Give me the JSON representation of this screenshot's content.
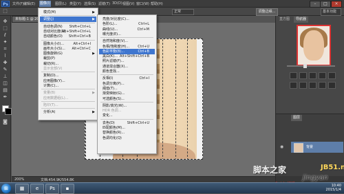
{
  "menubar": {
    "logo": "Ps",
    "items": [
      "文件(F)",
      "编辑(E)",
      "图像(I)",
      "图层(L)",
      "类型(Y)",
      "选择(S)",
      "滤镜(T)",
      "3D(D)",
      "视图(V)",
      "窗口(W)",
      "帮助(H)"
    ],
    "active_index": 2
  },
  "options": {
    "mode": "正常",
    "edge_button": "调整边缘...",
    "workspace": "基本功能"
  },
  "doc_tab": "未标题-1 @ 200% (背景, RGB/8)",
  "image_menu": {
    "items": [
      {
        "label": "模式(M)",
        "shortcut": "",
        "submenu": true,
        "state": "normal"
      },
      {
        "sep": true
      },
      {
        "label": "调整(J)",
        "shortcut": "",
        "submenu": true,
        "state": "highlight"
      },
      {
        "sep": true
      },
      {
        "label": "自动色调(N)",
        "shortcut": "Shift+Ctrl+L",
        "state": "normal"
      },
      {
        "label": "自动对比度(U)",
        "shortcut": "Alt+Shift+Ctrl+L",
        "state": "normal"
      },
      {
        "label": "自动颜色(O)",
        "shortcut": "Shift+Ctrl+B",
        "state": "normal"
      },
      {
        "sep": true
      },
      {
        "label": "图像大小(I)...",
        "shortcut": "Alt+Ctrl+I",
        "state": "normal"
      },
      {
        "label": "画布大小(S)...",
        "shortcut": "Alt+Ctrl+C",
        "state": "normal"
      },
      {
        "label": "图像旋转(G)",
        "shortcut": "",
        "submenu": true,
        "state": "normal"
      },
      {
        "label": "裁剪(P)",
        "shortcut": "",
        "state": "normal"
      },
      {
        "label": "裁切(R)...",
        "shortcut": "",
        "state": "normal"
      },
      {
        "label": "显示全部(V)",
        "shortcut": "",
        "state": "disabled"
      },
      {
        "sep": true
      },
      {
        "label": "复制(D)...",
        "shortcut": "",
        "state": "normal"
      },
      {
        "label": "应用图像(Y)...",
        "shortcut": "",
        "state": "normal"
      },
      {
        "label": "计算(C)...",
        "shortcut": "",
        "state": "normal"
      },
      {
        "sep": true
      },
      {
        "label": "变量(B)",
        "shortcut": "",
        "submenu": true,
        "state": "disabled"
      },
      {
        "label": "应用数据组(L)...",
        "shortcut": "",
        "state": "disabled"
      },
      {
        "sep": true
      },
      {
        "label": "陷印(T)...",
        "shortcut": "",
        "state": "disabled"
      },
      {
        "sep": true
      },
      {
        "label": "分析(A)",
        "shortcut": "",
        "submenu": true,
        "state": "normal"
      }
    ]
  },
  "adjust_menu": {
    "items": [
      {
        "label": "亮度/对比度(C)...",
        "shortcut": "",
        "state": "normal"
      },
      {
        "label": "色阶(L)...",
        "shortcut": "Ctrl+L",
        "state": "normal"
      },
      {
        "label": "曲线(U)...",
        "shortcut": "Ctrl+M",
        "state": "normal"
      },
      {
        "label": "曝光度(E)...",
        "shortcut": "",
        "state": "normal"
      },
      {
        "sep": true
      },
      {
        "label": "自然饱和度(V)...",
        "shortcut": "",
        "state": "normal"
      },
      {
        "label": "色相/饱和度(H)...",
        "shortcut": "Ctrl+U",
        "state": "normal"
      },
      {
        "label": "色彩平衡(B)...",
        "shortcut": "Ctrl+B",
        "state": "highlight"
      },
      {
        "label": "黑白(K)...",
        "shortcut": "Alt+Shift+Ctrl+B",
        "state": "normal"
      },
      {
        "label": "照片滤镜(F)...",
        "shortcut": "",
        "state": "normal"
      },
      {
        "label": "通道混合器(X)...",
        "shortcut": "",
        "state": "normal"
      },
      {
        "label": "颜色查找...",
        "shortcut": "",
        "state": "normal"
      },
      {
        "sep": true
      },
      {
        "label": "反相(I)",
        "shortcut": "Ctrl+I",
        "state": "normal"
      },
      {
        "label": "色调分离(P)...",
        "shortcut": "",
        "state": "normal"
      },
      {
        "label": "阈值(T)...",
        "shortcut": "",
        "state": "normal"
      },
      {
        "label": "渐变映射(G)...",
        "shortcut": "",
        "state": "normal"
      },
      {
        "label": "可选颜色(S)...",
        "shortcut": "",
        "state": "normal"
      },
      {
        "sep": true
      },
      {
        "label": "阴影/高光(W)...",
        "shortcut": "",
        "state": "normal"
      },
      {
        "label": "HDR 色调...",
        "shortcut": "",
        "state": "disabled"
      },
      {
        "label": "变化...",
        "shortcut": "",
        "state": "normal"
      },
      {
        "sep": true
      },
      {
        "label": "去色(D)",
        "shortcut": "Shift+Ctrl+U",
        "state": "normal"
      },
      {
        "label": "匹配颜色(M)...",
        "shortcut": "",
        "state": "normal"
      },
      {
        "label": "替换颜色(R)...",
        "shortcut": "",
        "state": "normal"
      },
      {
        "label": "色调均化(Q)",
        "shortcut": "",
        "state": "normal"
      }
    ]
  },
  "panels": {
    "tabs": [
      "直方图",
      "导航器"
    ],
    "layers_tab": "图层",
    "layer_name": "背景"
  },
  "status": {
    "zoom": "200%",
    "doc": "文档:454.9K/554.8K"
  },
  "taskbar": {
    "time": "10:40",
    "date": "2015/1/4"
  },
  "watermark": {
    "main": "脚本之家",
    "site": "jingyan",
    "domain": "JB51.net",
    "baidu": "Baidu经验"
  },
  "colors": {
    "highlight": "#3f76cf",
    "menubar": "#3c3c3c",
    "canvas": "#6e6e6e"
  }
}
